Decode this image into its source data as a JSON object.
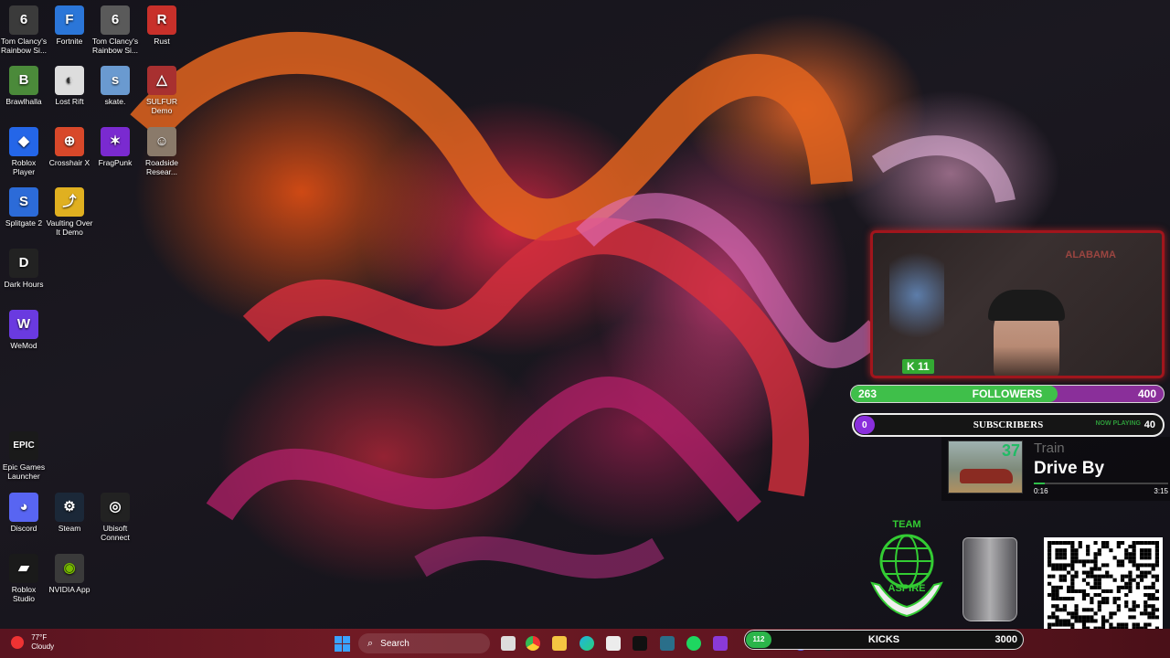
{
  "desktop_icons": [
    {
      "label": "Tom Clancy's Rainbow Si...",
      "icon": "rainbow-six-icon",
      "color": "#3b3b3b",
      "glyph": "6"
    },
    {
      "label": "Fortnite",
      "icon": "fortnite-icon",
      "color": "#2b76d8",
      "glyph": "F"
    },
    {
      "label": "Tom Clancy's Rainbow Si...",
      "icon": "rainbow-six-icon",
      "color": "#5a5a5a",
      "glyph": "6"
    },
    {
      "label": "Rust",
      "icon": "rust-icon",
      "color": "#c8302a",
      "glyph": "R"
    },
    {
      "label": "Brawlhalla",
      "icon": "brawlhalla-icon",
      "color": "#4b8a3a",
      "glyph": "B"
    },
    {
      "label": "Lost Rift",
      "icon": "lost-rift-icon",
      "color": "#dddddd",
      "glyph": "◐"
    },
    {
      "label": "skate.",
      "icon": "skate-icon",
      "color": "#6a9ad0",
      "glyph": "s"
    },
    {
      "label": "SULFUR Demo",
      "icon": "sulfur-icon",
      "color": "#a83030",
      "glyph": "△"
    },
    {
      "label": "Roblox Player",
      "icon": "roblox-icon",
      "color": "#2466e8",
      "glyph": "◆"
    },
    {
      "label": "Crosshair X",
      "icon": "crosshair-icon",
      "color": "#d8482a",
      "glyph": "⊕"
    },
    {
      "label": "FragPunk",
      "icon": "fragpunk-icon",
      "color": "#7a2ad0",
      "glyph": "✶"
    },
    {
      "label": "Roadside Resear...",
      "icon": "roadside-research-icon",
      "color": "#8a7a6a",
      "glyph": "☺"
    },
    {
      "label": "Splitgate 2",
      "icon": "splitgate-icon",
      "color": "#2c6bd8",
      "glyph": "S"
    },
    {
      "label": "Vaulting Over It Demo",
      "icon": "vaulting-icon",
      "color": "#e0b020",
      "glyph": "⤴"
    },
    {
      "label": "Dark Hours",
      "icon": "dark-hours-icon",
      "color": "#222222",
      "glyph": "D"
    },
    {
      "label": "WeMod",
      "icon": "wemod-icon",
      "color": "#6a3ae0",
      "glyph": "W"
    },
    {
      "label": "Epic Games Launcher",
      "icon": "epic-games-icon",
      "color": "#1a1a1a",
      "glyph": "E"
    },
    {
      "label": "Discord",
      "icon": "discord-icon",
      "color": "#5865f2",
      "glyph": "◕"
    },
    {
      "label": "Steam",
      "icon": "steam-icon",
      "color": "#1b2838",
      "glyph": "⚙"
    },
    {
      "label": "Ubisoft Connect",
      "icon": "ubisoft-icon",
      "color": "#222222",
      "glyph": "◎"
    },
    {
      "label": "Roblox Studio",
      "icon": "roblox-studio-icon",
      "color": "#1a1a1a",
      "glyph": "▰"
    },
    {
      "label": "NVIDIA App",
      "icon": "nvidia-icon",
      "color": "#3a3a3a",
      "glyph": "◉"
    }
  ],
  "webcam": {
    "badge": "K 11",
    "sign": "ALABAMA"
  },
  "followers": {
    "current": "263",
    "label": "FOLLOWERS",
    "goal": "400",
    "progress": 0.66
  },
  "subscribers": {
    "current": "0",
    "label": "SUBSCRIBERS",
    "goal": "40",
    "now_playing": "NOW PLAYING"
  },
  "music": {
    "album_number": "37",
    "artist": "Train",
    "track": "Drive By",
    "elapsed": "0:16",
    "duration": "3:15",
    "progress": 0.08
  },
  "team": {
    "title": "TEAM",
    "name": "ASPIRE"
  },
  "taskbar": {
    "weather": {
      "temp": "77°F",
      "condition": "Cloudy"
    },
    "search_label": "Search",
    "apps": [
      "task-view-icon",
      "chrome-icon",
      "file-explorer-icon",
      "edge-icon",
      "store-icon",
      "tiktok-icon",
      "media-icon",
      "spotify-icon",
      "app-icon",
      "discord-icon",
      "obs-icon"
    ]
  },
  "kicks": {
    "current": "112",
    "label": "KICKS",
    "goal": "3000"
  },
  "colors": {
    "followers_fill": "#3fbf4a",
    "followers_track": "#8a2f9a",
    "taskbar": "#701a24",
    "cam_border": "#a1151c"
  }
}
